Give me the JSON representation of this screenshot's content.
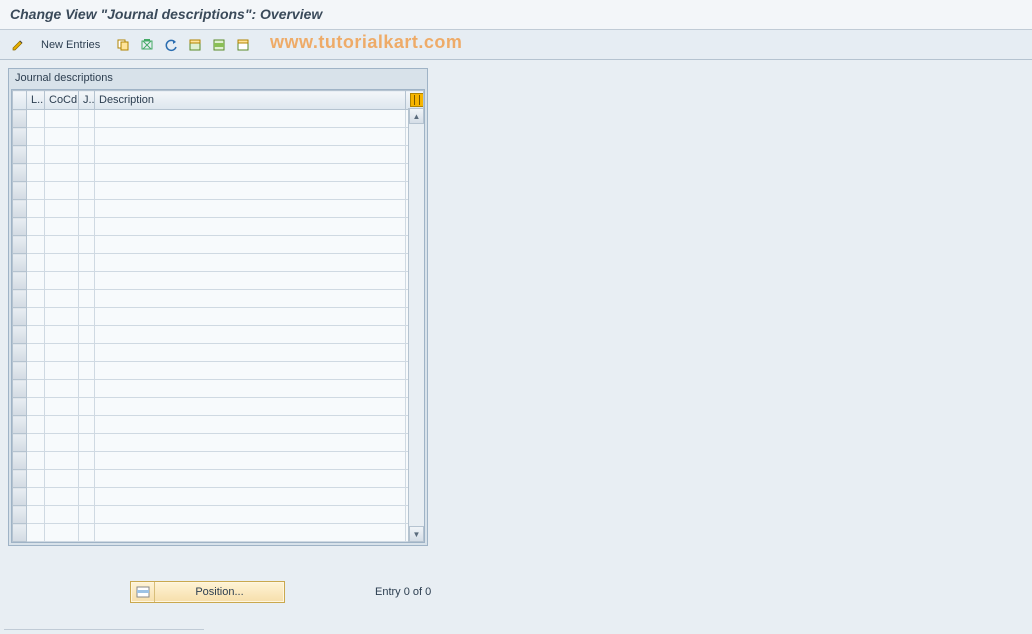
{
  "header": {
    "title": "Change View \"Journal descriptions\": Overview"
  },
  "toolbar": {
    "new_entries_label": "New Entries"
  },
  "watermark": {
    "text": "www.tutorialkart.com"
  },
  "panel": {
    "title": "Journal descriptions",
    "columns": {
      "sel": "",
      "l": "L..",
      "cocd": "CoCd",
      "j": "J..",
      "desc": "Description"
    },
    "row_count": 24
  },
  "footer": {
    "position_label": "Position...",
    "entry_status": "Entry 0 of 0"
  },
  "icons": {
    "pencil": "pencil-icon",
    "copy": "copy-icon",
    "export": "export-icon",
    "undo": "undo-icon",
    "select_all": "select-all-icon",
    "select_block": "select-block-icon",
    "deselect": "deselect-icon",
    "config": "table-config-icon",
    "uparrow": "▲",
    "downarrow": "▼"
  }
}
